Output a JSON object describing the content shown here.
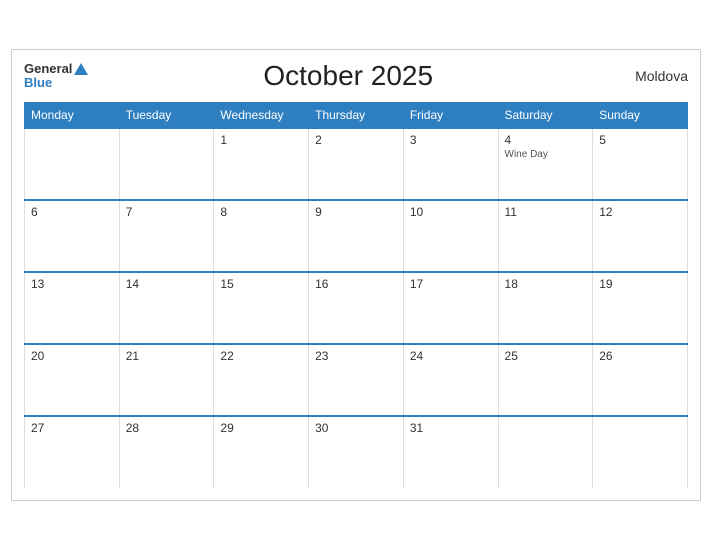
{
  "header": {
    "title": "October 2025",
    "country": "Moldova",
    "logo_general": "General",
    "logo_blue": "Blue"
  },
  "days_of_week": [
    "Monday",
    "Tuesday",
    "Wednesday",
    "Thursday",
    "Friday",
    "Saturday",
    "Sunday"
  ],
  "weeks": [
    [
      {
        "day": "",
        "empty": true
      },
      {
        "day": "",
        "empty": true
      },
      {
        "day": "1",
        "empty": false
      },
      {
        "day": "2",
        "empty": false
      },
      {
        "day": "3",
        "empty": false
      },
      {
        "day": "4",
        "empty": false,
        "event": "Wine Day"
      },
      {
        "day": "5",
        "empty": false
      }
    ],
    [
      {
        "day": "6",
        "empty": false
      },
      {
        "day": "7",
        "empty": false
      },
      {
        "day": "8",
        "empty": false
      },
      {
        "day": "9",
        "empty": false
      },
      {
        "day": "10",
        "empty": false
      },
      {
        "day": "11",
        "empty": false
      },
      {
        "day": "12",
        "empty": false
      }
    ],
    [
      {
        "day": "13",
        "empty": false
      },
      {
        "day": "14",
        "empty": false
      },
      {
        "day": "15",
        "empty": false
      },
      {
        "day": "16",
        "empty": false
      },
      {
        "day": "17",
        "empty": false
      },
      {
        "day": "18",
        "empty": false
      },
      {
        "day": "19",
        "empty": false
      }
    ],
    [
      {
        "day": "20",
        "empty": false
      },
      {
        "day": "21",
        "empty": false
      },
      {
        "day": "22",
        "empty": false
      },
      {
        "day": "23",
        "empty": false
      },
      {
        "day": "24",
        "empty": false
      },
      {
        "day": "25",
        "empty": false
      },
      {
        "day": "26",
        "empty": false
      }
    ],
    [
      {
        "day": "27",
        "empty": false
      },
      {
        "day": "28",
        "empty": false
      },
      {
        "day": "29",
        "empty": false
      },
      {
        "day": "30",
        "empty": false
      },
      {
        "day": "31",
        "empty": false
      },
      {
        "day": "",
        "empty": true
      },
      {
        "day": "",
        "empty": true
      }
    ]
  ]
}
